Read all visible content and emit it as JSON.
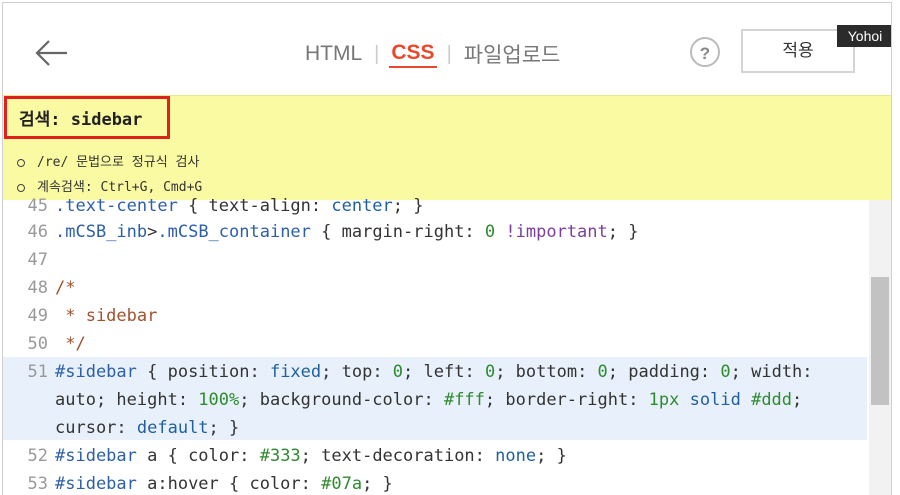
{
  "header": {
    "tabs": [
      {
        "label": "HTML",
        "active": false
      },
      {
        "label": "CSS",
        "active": true
      },
      {
        "label": "파일업로드",
        "active": false
      }
    ],
    "help_label": "?",
    "apply_label": "적용",
    "user_badge": "Yohoi"
  },
  "search": {
    "value": "검색: sidebar",
    "hints": [
      "/re/ 문법으로 정규식 검사",
      "계속검색: Ctrl+G, Cmd+G"
    ]
  },
  "code_lines": [
    {
      "num": "45",
      "text": ".text-center { text-align: center; }"
    },
    {
      "num": "46",
      "text": ".mCSB_inb>.mCSB_container { margin-right: 0 !important; }"
    },
    {
      "num": "47",
      "text": ""
    },
    {
      "num": "48",
      "text": "/*"
    },
    {
      "num": "49",
      "text": " * sidebar"
    },
    {
      "num": "50",
      "text": " */"
    },
    {
      "num": "51",
      "text": "#sidebar { position: fixed; top: 0; left: 0; bottom: 0; padding: 0; width:"
    },
    {
      "num": "",
      "text": "auto; height: 100%; background-color: #fff; border-right: 1px solid #ddd;"
    },
    {
      "num": "",
      "text": "cursor: default; }"
    },
    {
      "num": "52",
      "text": "#sidebar a { color: #333; text-decoration: none; }"
    },
    {
      "num": "53",
      "text": "#sidebar a:hover { color: #07a; }"
    }
  ],
  "colors": {
    "accent": "#e8492d",
    "search_bg": "#fafaa2",
    "search_border": "#e0201a",
    "highlight_line": "#e8f1fb"
  }
}
